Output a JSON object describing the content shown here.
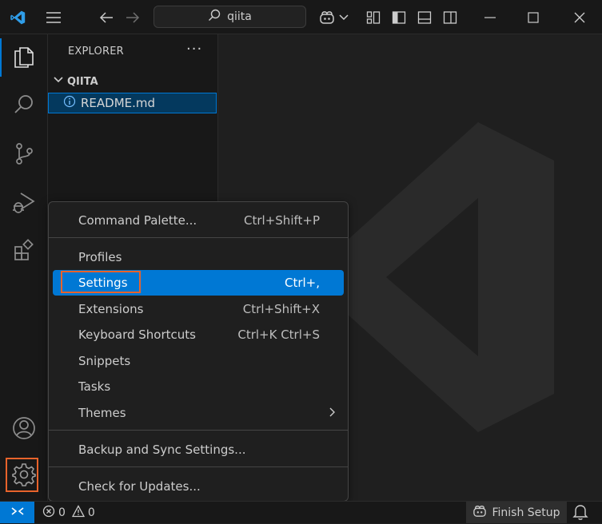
{
  "titlebar": {
    "search_text": "qiita",
    "icons": [
      "vscode-logo-icon",
      "menu-icon",
      "back-arrow-icon",
      "forward-arrow-icon",
      "search-icon",
      "copilot-icon",
      "chevron-down-icon",
      "customize-layout-icon",
      "toggle-sidebar-icon",
      "toggle-panel-icon",
      "toggle-secondary-sidebar-icon",
      "minimize-icon",
      "maximize-icon",
      "close-icon"
    ]
  },
  "activitybar": {
    "items": [
      {
        "name": "explorer",
        "icon": "files-icon",
        "active": true
      },
      {
        "name": "search",
        "icon": "search-icon"
      },
      {
        "name": "source-control",
        "icon": "source-control-icon"
      },
      {
        "name": "run-debug",
        "icon": "run-debug-icon"
      },
      {
        "name": "extensions",
        "icon": "extensions-icon"
      }
    ],
    "bottom": [
      {
        "name": "accounts",
        "icon": "account-icon"
      },
      {
        "name": "manage",
        "icon": "gear-icon",
        "highlighted": true
      }
    ]
  },
  "sidebar": {
    "title": "EXPLORER",
    "more": "···",
    "section": "QIITA",
    "files": [
      {
        "name": "README.md",
        "icon": "info-icon",
        "selected": true
      }
    ]
  },
  "menu": {
    "items": [
      {
        "label": "Command Palette...",
        "shortcut": "Ctrl+Shift+P"
      },
      {
        "label": "Profiles",
        "shortcut": ""
      },
      {
        "label": "Settings",
        "shortcut": "Ctrl+,",
        "selected": true
      },
      {
        "label": "Extensions",
        "shortcut": "Ctrl+Shift+X"
      },
      {
        "label": "Keyboard Shortcuts",
        "shortcut": "Ctrl+K Ctrl+S"
      },
      {
        "label": "Snippets",
        "shortcut": ""
      },
      {
        "label": "Tasks",
        "shortcut": ""
      },
      {
        "label": "Themes",
        "shortcut": "",
        "submenu": true
      },
      {
        "label": "Backup and Sync Settings...",
        "shortcut": ""
      },
      {
        "label": "Check for Updates...",
        "shortcut": ""
      }
    ]
  },
  "statusbar": {
    "errors": "0",
    "warnings": "0",
    "finish_setup": "Finish Setup"
  },
  "colors": {
    "accent": "#0078d4",
    "highlight_box": "#e8632b",
    "background": "#1f1f1f"
  }
}
